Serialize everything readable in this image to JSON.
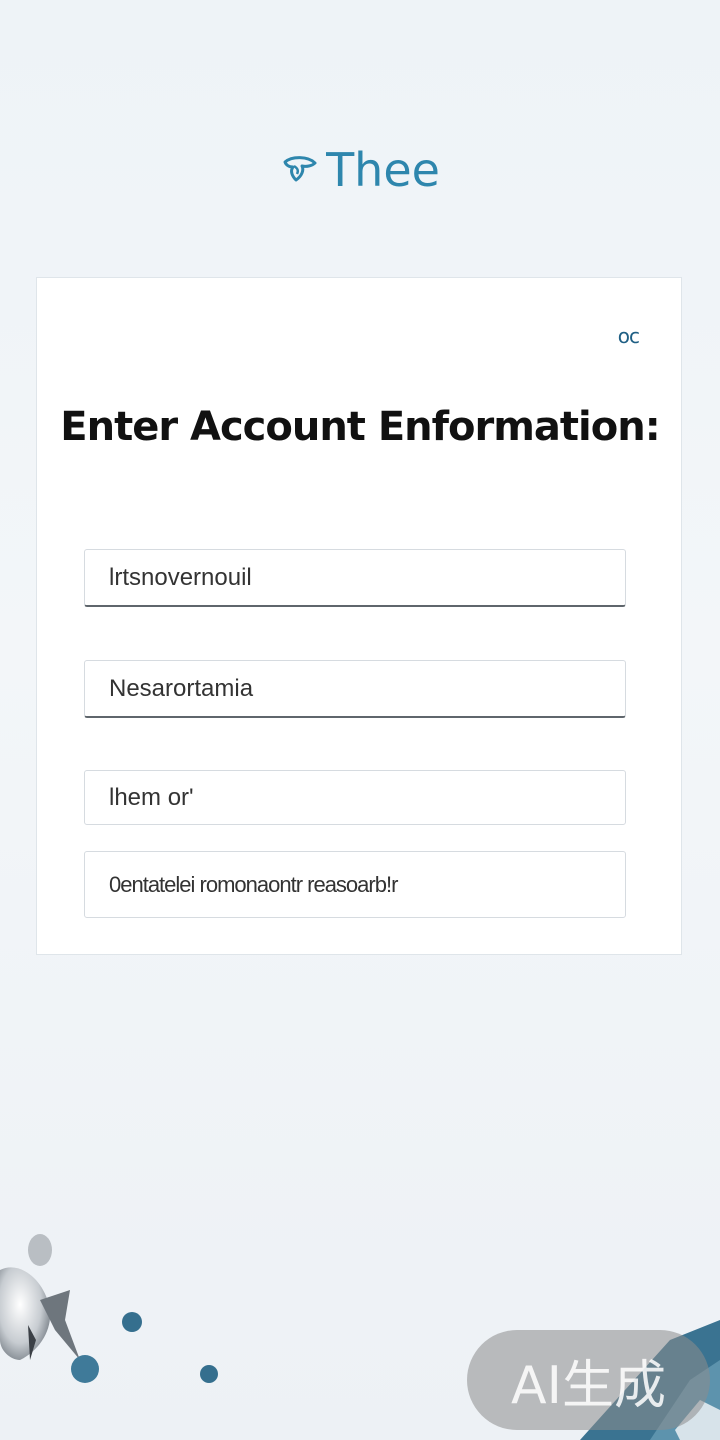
{
  "app": {
    "brand_name": "Thee",
    "brand_icon": "leaf-heart-icon",
    "brand_color": "#2e86ad"
  },
  "card": {
    "corner_icon_text": "oc",
    "title": "Enter Account Enformation:"
  },
  "form": {
    "fields": [
      {
        "value": "",
        "placeholder": "lrtsnovernouil"
      },
      {
        "value": "",
        "placeholder": "Nesarortamia"
      },
      {
        "value": "",
        "placeholder": "lhem or'"
      },
      {
        "value": "",
        "placeholder": "0entatelei romonaontr reasoarb!r"
      }
    ]
  },
  "watermark": {
    "text": "AI生成"
  },
  "colors": {
    "accent": "#2e86ad",
    "dots": "#356f8e",
    "background": "#eef2f6"
  }
}
